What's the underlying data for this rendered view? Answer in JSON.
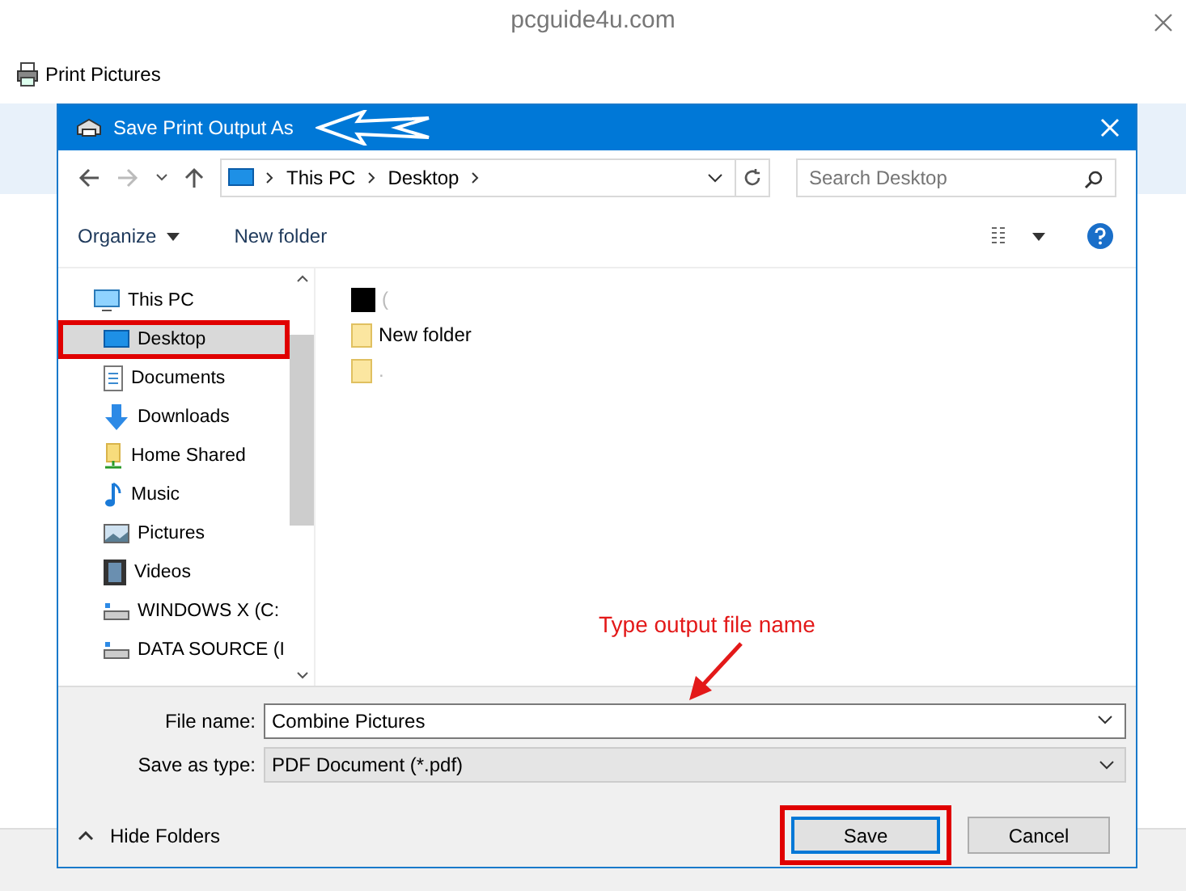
{
  "site_caption": "pcguide4u.com",
  "background_window": {
    "title": "Print Pictures"
  },
  "dialog": {
    "title": "Save Print Output As",
    "address": {
      "crumbs": [
        "This PC",
        "Desktop"
      ],
      "search_placeholder": "Search Desktop"
    },
    "toolbar": {
      "organize": "Organize",
      "new_folder": "New folder"
    },
    "tree": [
      {
        "label": "This PC",
        "kind": "pc",
        "selected": false,
        "children": [
          {
            "label": "Desktop",
            "kind": "desktop",
            "selected": true
          },
          {
            "label": "Documents",
            "kind": "documents",
            "selected": false
          },
          {
            "label": "Downloads",
            "kind": "downloads",
            "selected": false
          },
          {
            "label": "Home Shared",
            "kind": "shared",
            "selected": false
          },
          {
            "label": "Music",
            "kind": "music",
            "selected": false
          },
          {
            "label": "Pictures",
            "kind": "pictures",
            "selected": false
          },
          {
            "label": "Videos",
            "kind": "videos",
            "selected": false
          },
          {
            "label": "WINDOWS X (C:",
            "kind": "drive",
            "selected": false
          },
          {
            "label": "DATA SOURCE (I",
            "kind": "drive",
            "selected": false
          }
        ]
      }
    ],
    "files": [
      {
        "name": "(",
        "kind": "blank"
      },
      {
        "name": "New folder",
        "kind": "folder"
      },
      {
        "name": ".",
        "kind": "folder"
      }
    ],
    "file_name": {
      "label": "File name:",
      "value": "Combine Pictures"
    },
    "save_type": {
      "label": "Save as type:",
      "value": "PDF Document (*.pdf)"
    },
    "hide_folders": "Hide Folders",
    "buttons": {
      "save": "Save",
      "cancel": "Cancel"
    },
    "annotation": "Type output file name"
  }
}
